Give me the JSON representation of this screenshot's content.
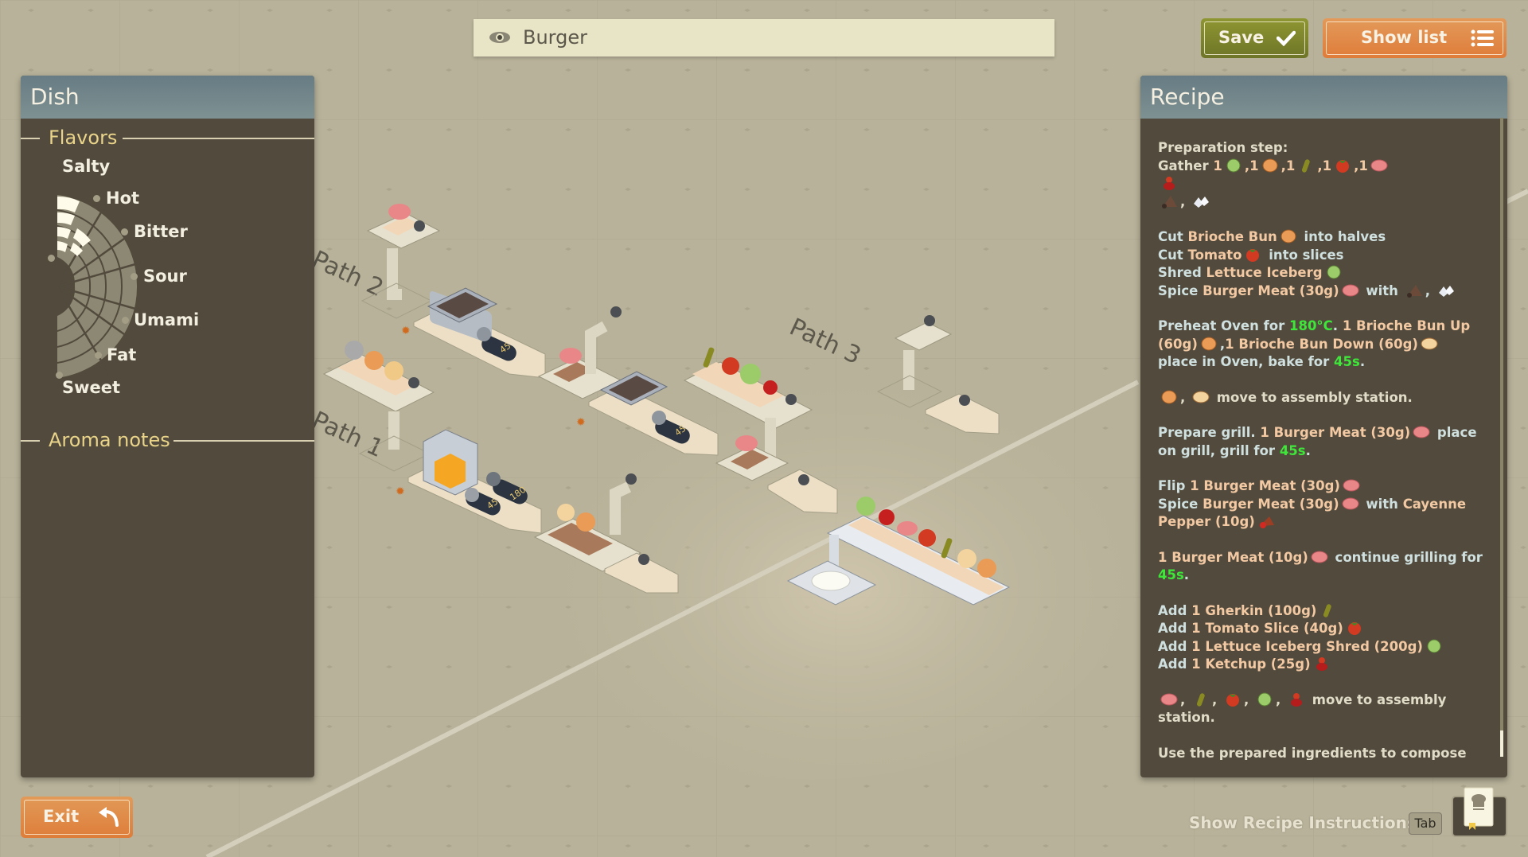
{
  "search": {
    "value": "Burger",
    "icon": "eye-icon"
  },
  "toolbar": {
    "save_label": "Save",
    "save_icon": "checkmark-icon",
    "show_list_label": "Show list",
    "show_list_icon": "list-icon",
    "save_color": "#7d8530",
    "show_list_color": "#e08a48"
  },
  "dish_panel": {
    "title": "Dish",
    "flavors_title": "Flavors",
    "flavors": [
      {
        "label": "Salty",
        "level": 0.2
      },
      {
        "label": "Hot",
        "level": 0
      },
      {
        "label": "Bitter",
        "level": 0
      },
      {
        "label": "Sour",
        "level": 0
      },
      {
        "label": "Umami",
        "level": 0
      },
      {
        "label": "Fat",
        "level": 0
      },
      {
        "label": "Sweet",
        "level": 0
      }
    ],
    "flavor_wheel_highlight": {
      "Salty": 5,
      "Hot": 3
    },
    "aroma_title": "Aroma notes"
  },
  "canvas": {
    "paths": [
      {
        "label": "Path 1"
      },
      {
        "label": "Path 2"
      },
      {
        "label": "Path 3"
      }
    ],
    "stations": [
      {
        "type": "grill",
        "timer": "45"
      },
      {
        "type": "grill",
        "timer": "45"
      },
      {
        "type": "oven",
        "timer": "45",
        "temperature": "180"
      }
    ]
  },
  "recipe_panel": {
    "title": "Recipe",
    "scroll_position": 0.95,
    "steps": [
      {
        "parts": [
          {
            "t": "Preparation step:",
            "c": "plain"
          },
          {
            "br": true
          },
          {
            "t": "Gather ",
            "c": "plain"
          },
          {
            "t": "1",
            "c": "n"
          },
          {
            "icon": "lettuce"
          },
          {
            "t": ",1",
            "c": "n"
          },
          {
            "icon": "bun"
          },
          {
            "t": ",1",
            "c": "n"
          },
          {
            "icon": "gherkin"
          },
          {
            "t": ",1",
            "c": "n"
          },
          {
            "icon": "tomato"
          },
          {
            "t": ",1",
            "c": "n"
          },
          {
            "icon": "meat"
          },
          {
            "br": true
          },
          {
            "icon": "ketchup"
          },
          {
            "br": true
          },
          {
            "icon": "pepper"
          },
          {
            "t": ", ",
            "c": "plain"
          },
          {
            "icon": "salt"
          }
        ]
      },
      {
        "parts": [
          {
            "t": "Cut ",
            "c": "v"
          },
          {
            "t": "Brioche Bun",
            "c": "n"
          },
          {
            "icon": "bun"
          },
          {
            "t": " into halves",
            "c": "v"
          },
          {
            "br": true
          },
          {
            "t": "Cut ",
            "c": "v"
          },
          {
            "t": "Tomato",
            "c": "n"
          },
          {
            "icon": "tomato"
          },
          {
            "t": " into slices",
            "c": "v"
          },
          {
            "br": true
          },
          {
            "t": "Shred ",
            "c": "v"
          },
          {
            "t": "Lettuce Iceberg",
            "c": "n"
          },
          {
            "icon": "lettuce"
          },
          {
            "br": true
          },
          {
            "t": "Spice ",
            "c": "v"
          },
          {
            "t": "Burger Meat (30g)",
            "c": "n"
          },
          {
            "icon": "meat"
          },
          {
            "t": " with ",
            "c": "v"
          },
          {
            "icon": "pepper"
          },
          {
            "t": ", ",
            "c": "v"
          },
          {
            "icon": "salt"
          }
        ]
      },
      {
        "parts": [
          {
            "t": "Preheat Oven for ",
            "c": "v"
          },
          {
            "t": "180°C",
            "c": "g"
          },
          {
            "t": ". ",
            "c": "v"
          },
          {
            "t": "1 Brioche Bun Up (60g)",
            "c": "n"
          },
          {
            "icon": "bun"
          },
          {
            "t": ",",
            "c": "v"
          },
          {
            "t": "1 Brioche Bun Down (60g)",
            "c": "n"
          },
          {
            "icon": "bun-bottom"
          },
          {
            "t": " place in Oven, bake for ",
            "c": "v"
          },
          {
            "t": "45s",
            "c": "g"
          },
          {
            "t": ".",
            "c": "v"
          }
        ]
      },
      {
        "parts": [
          {
            "icon": "bun"
          },
          {
            "t": ", ",
            "c": "plain"
          },
          {
            "icon": "bun-bottom"
          },
          {
            "t": " move to assembly station.",
            "c": "plain"
          }
        ]
      },
      {
        "parts": [
          {
            "t": "Prepare grill. ",
            "c": "v"
          },
          {
            "t": "1 Burger Meat (30g)",
            "c": "n"
          },
          {
            "icon": "meat"
          },
          {
            "t": " place on grill, grill for ",
            "c": "v"
          },
          {
            "t": "45s",
            "c": "g"
          },
          {
            "t": ".",
            "c": "v"
          }
        ]
      },
      {
        "parts": [
          {
            "t": "Flip ",
            "c": "v"
          },
          {
            "t": "1 Burger Meat (30g)",
            "c": "n"
          },
          {
            "icon": "meat"
          },
          {
            "br": true
          },
          {
            "t": "Spice ",
            "c": "v"
          },
          {
            "t": "Burger Meat (30g)",
            "c": "n"
          },
          {
            "icon": "meat"
          },
          {
            "t": " with ",
            "c": "v"
          },
          {
            "t": "Cayenne Pepper (10g)",
            "c": "n"
          },
          {
            "icon": "cayenne"
          }
        ]
      },
      {
        "parts": [
          {
            "t": "1 Burger Meat (10g)",
            "c": "n"
          },
          {
            "icon": "meat"
          },
          {
            "t": " continue grilling for ",
            "c": "v"
          },
          {
            "t": "45s",
            "c": "g"
          },
          {
            "t": ".",
            "c": "v"
          }
        ]
      },
      {
        "parts": [
          {
            "t": "Add ",
            "c": "v"
          },
          {
            "t": "1 Gherkin (100g)",
            "c": "n"
          },
          {
            "icon": "gherkin"
          },
          {
            "br": true
          },
          {
            "t": "Add ",
            "c": "v"
          },
          {
            "t": "1 Tomato Slice (40g)",
            "c": "n"
          },
          {
            "icon": "tomato"
          },
          {
            "br": true
          },
          {
            "t": "Add ",
            "c": "v"
          },
          {
            "t": "1 Lettuce Iceberg Shred (200g)",
            "c": "n"
          },
          {
            "icon": "lettuce"
          },
          {
            "br": true
          },
          {
            "t": "Add ",
            "c": "v"
          },
          {
            "t": "1 Ketchup (25g)",
            "c": "n"
          },
          {
            "icon": "ketchup"
          }
        ]
      },
      {
        "parts": [
          {
            "icon": "meat"
          },
          {
            "t": ", ",
            "c": "plain"
          },
          {
            "icon": "gherkin"
          },
          {
            "t": ", ",
            "c": "plain"
          },
          {
            "icon": "tomato"
          },
          {
            "t": ", ",
            "c": "plain"
          },
          {
            "icon": "lettuce"
          },
          {
            "t": ", ",
            "c": "plain"
          },
          {
            "icon": "ketchup"
          },
          {
            "t": " move to assembly station.",
            "c": "plain"
          }
        ]
      },
      {
        "parts": [
          {
            "t": "Use the prepared ingredients to compose your",
            "c": "plain"
          }
        ]
      }
    ]
  },
  "footer": {
    "exit_label": "Exit",
    "exit_icon": "back-arrow-icon",
    "hint_label": "Show Recipe Instructions",
    "hint_key": "Tab",
    "recipe_book_icon": "recipe-book-icon"
  }
}
